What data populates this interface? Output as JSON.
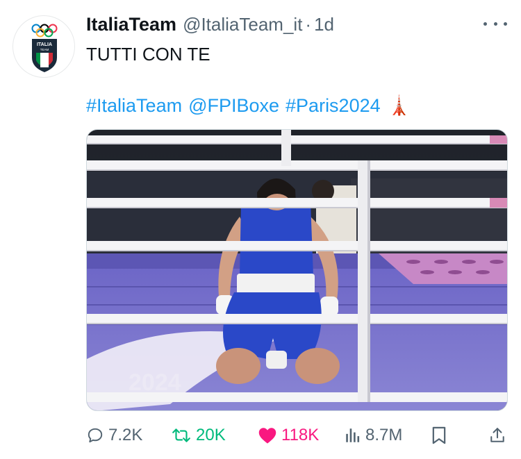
{
  "tweet": {
    "author_name": "ItaliaTeam",
    "handle": "@ItaliaTeam_it",
    "separator": "·",
    "time": "1d",
    "text": "TUTTI CON TE",
    "hashtags": [
      "#ItaliaTeam",
      "@FPIBoxe",
      "#Paris2024"
    ],
    "emoji": "🗼"
  },
  "avatar": {
    "logo_text_line1": "ITALIA",
    "logo_text_line2": "TEAM"
  },
  "media": {
    "kind": "photo",
    "floor_text": "2024"
  },
  "actions": {
    "replies": "7.2K",
    "retweets": "20K",
    "likes": "118K",
    "views": "8.7M"
  },
  "colors": {
    "accent": "#1d9bf0",
    "retweet": "#00ba7c",
    "like": "#f91880",
    "muted": "#536471",
    "text": "#0f1419"
  },
  "icons": [
    "more-icon",
    "reply-icon",
    "retweet-icon",
    "like-icon",
    "views-icon",
    "bookmark-icon",
    "share-icon"
  ]
}
